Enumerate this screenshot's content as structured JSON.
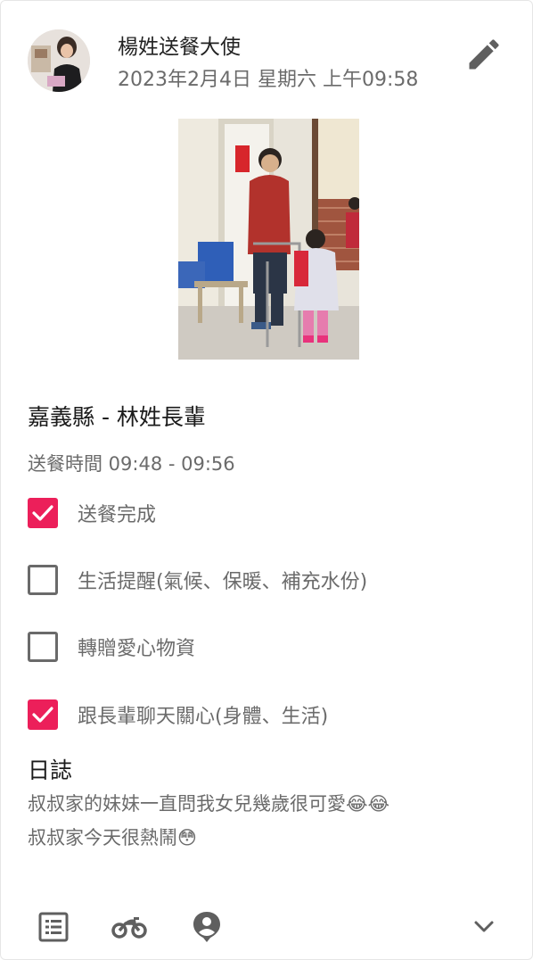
{
  "post": {
    "author": "楊姓送餐大使",
    "datetime": "2023年2月4日 星期六 上午09:58",
    "elder_title": "嘉義縣 - 林姓長輩",
    "time_range": "送餐時間 09:48 - 09:56"
  },
  "checklist": [
    {
      "label": "送餐完成",
      "checked": true
    },
    {
      "label": "生活提醒(氣候、保暖、補充水份)",
      "checked": false
    },
    {
      "label": "轉贈愛心物資",
      "checked": false
    },
    {
      "label": "跟長輩聊天關心(身體、生活)",
      "checked": true
    }
  ],
  "log": {
    "heading": "日誌",
    "lines": [
      "叔叔家的妹妹一直問我女兒幾歲很可愛😂😂",
      "叔叔家今天很熱鬧😳"
    ]
  },
  "colors": {
    "accent": "#ec1f5a",
    "muted_text": "#6b6b6b",
    "icon": "#5f5f5f"
  },
  "icons": {
    "edit": "pencil-icon",
    "bottom_left": "list-icon",
    "bottom_second": "motorcycle-icon",
    "bottom_third": "person-pin-icon",
    "bottom_right": "chevron-down-icon"
  }
}
